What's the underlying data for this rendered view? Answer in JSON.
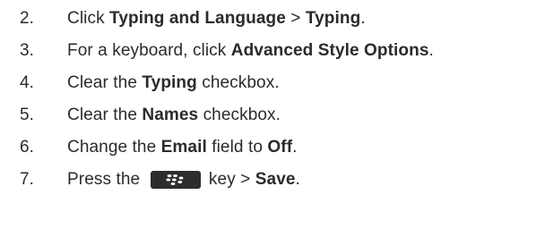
{
  "steps": [
    {
      "number": "2.",
      "parts": [
        "Click ",
        "Typing and Language",
        " > ",
        "Typing",
        "."
      ]
    },
    {
      "number": "3.",
      "parts": [
        "For a keyboard, click ",
        "Advanced Style Options",
        "."
      ]
    },
    {
      "number": "4.",
      "parts": [
        "Clear the ",
        "Typing",
        " checkbox."
      ]
    },
    {
      "number": "5.",
      "parts": [
        "Clear the ",
        "Names",
        " checkbox."
      ]
    },
    {
      "number": "6.",
      "parts": [
        "Change the ",
        "Email",
        " field to ",
        "Off",
        "."
      ]
    },
    {
      "number": "7.",
      "parts": [
        "Press the ",
        " key > ",
        "Save",
        "."
      ],
      "key_icon": "blackberry-menu-key-icon"
    }
  ],
  "colors": {
    "text": "#2b2b2b",
    "key_background": "#2d2d2d",
    "key_glyph": "#ffffff"
  }
}
